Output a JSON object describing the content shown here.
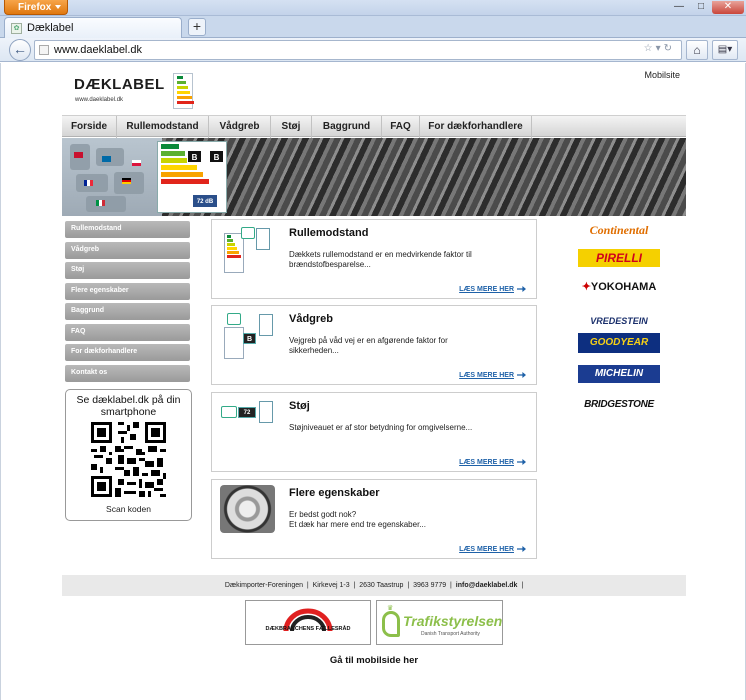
{
  "browser": {
    "app_button": "Firefox",
    "tab_title": "Dæklabel",
    "new_tab": "+",
    "url": "www.daeklabel.dk"
  },
  "site": {
    "logo_text": "DÆKLABEL",
    "logo_sub": "www.daeklabel.dk",
    "mobile_link": "Mobilsite",
    "nav": [
      "Forside",
      "Rullemodstand",
      "Vådgreb",
      "Støj",
      "Baggrund",
      "FAQ",
      "For dækforhandlere"
    ],
    "sidebar": [
      "Rullemodstand",
      "Vådgreb",
      "Støj",
      "Flere egenskaber",
      "Baggrund",
      "FAQ",
      "For dækforhandlere",
      "Kontakt os"
    ],
    "qr": {
      "title": "Se dæklabel.dk på din smartphone",
      "caption": "Scan koden"
    },
    "hero": {
      "rating_b": "B",
      "noise": "72 dB"
    },
    "cards": [
      {
        "title": "Rullemodstand",
        "desc": "Dækkets rullemodstand er en medvirkende faktor til brændstofbesparelse...",
        "more": "LÆS MERE HER"
      },
      {
        "title": "Vådgreb",
        "desc": "Vejgreb på våd vej er en afgørende faktor for sikkerheden...",
        "more": "LÆS MERE HER"
      },
      {
        "title": "Støj",
        "desc": "Støjniveauet er af stor betydning for omgivelserne...",
        "more": "LÆS MERE HER"
      },
      {
        "title": "Flere egenskaber",
        "desc": "Er bedst godt nok?\nEt dæk har mere end tre egenskaber...",
        "more": "LÆS MERE HER"
      }
    ],
    "brands": [
      "Continental",
      "PIRELLI",
      "YOKOHAMA",
      "VREDESTEIN",
      "GOODYEAR",
      "MICHELIN",
      "BRIDGESTONE"
    ],
    "footer": {
      "org": "Dækimporter-Foreningen",
      "address": "Kirkevej 1-3",
      "city": "2630 Taastrup",
      "phone": "3963 9779",
      "email": "info@daeklabel.dk"
    },
    "logos": {
      "dtf": "DÆKBRANCHENS FÆLLESRÅD",
      "trafik": "Trafikstyrelsen",
      "trafik_sub": "Danish Transport Authority"
    },
    "mobile_bottom": "Gå til mobilside her"
  },
  "colors": {
    "accent_link": "#1e61a8",
    "sidebar_btn": "#a8a8a8",
    "firefox_orange": "#e8841c"
  }
}
